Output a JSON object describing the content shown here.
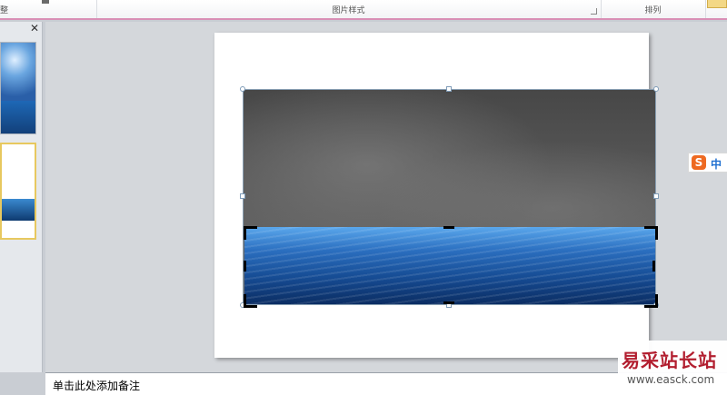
{
  "ribbon": {
    "group_left_label": "整",
    "group_picture_styles_label": "图片样式",
    "group_arrange_label": "排列"
  },
  "thumbnails_pane": {
    "close_glyph": "✕"
  },
  "notes": {
    "placeholder": "单击此处添加备注"
  },
  "ime": {
    "logo": "S",
    "mode": "中"
  },
  "watermark": {
    "title": "易采站长站",
    "url": "www.easck.com"
  },
  "colors": {
    "ribbon_accent": "#d98fb6",
    "selection_handle": "#7f9cb8",
    "ime_orange": "#ee6a22",
    "watermark_red": "#b21e2f"
  }
}
